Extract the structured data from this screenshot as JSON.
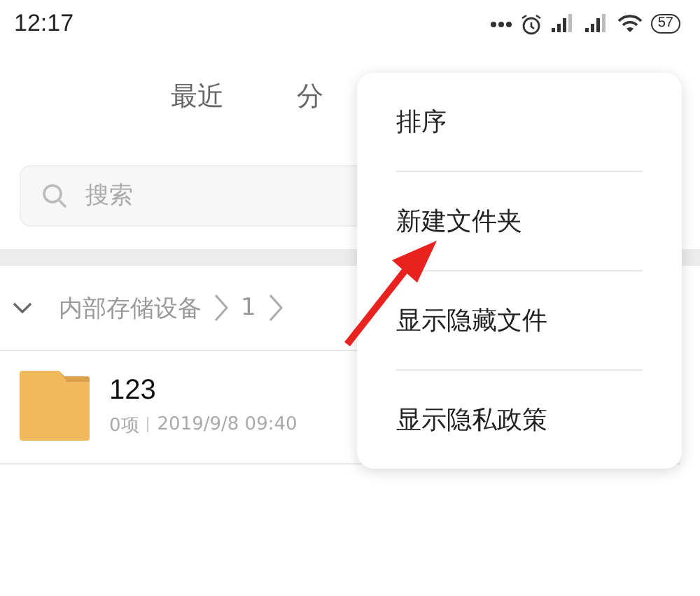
{
  "status_bar": {
    "time": "12:17",
    "battery": "57"
  },
  "tabs": [
    {
      "label": "最近"
    },
    {
      "label": "分"
    }
  ],
  "search": {
    "placeholder": "搜索"
  },
  "breadcrumb": {
    "expanded": true,
    "items": [
      "内部存储设备",
      "1"
    ]
  },
  "files": [
    {
      "name": "123",
      "count": "0项",
      "date": "2019/9/8 09:40"
    }
  ],
  "menu": {
    "items": [
      "排序",
      "新建文件夹",
      "显示隐藏文件",
      "显示隐私政策"
    ]
  }
}
